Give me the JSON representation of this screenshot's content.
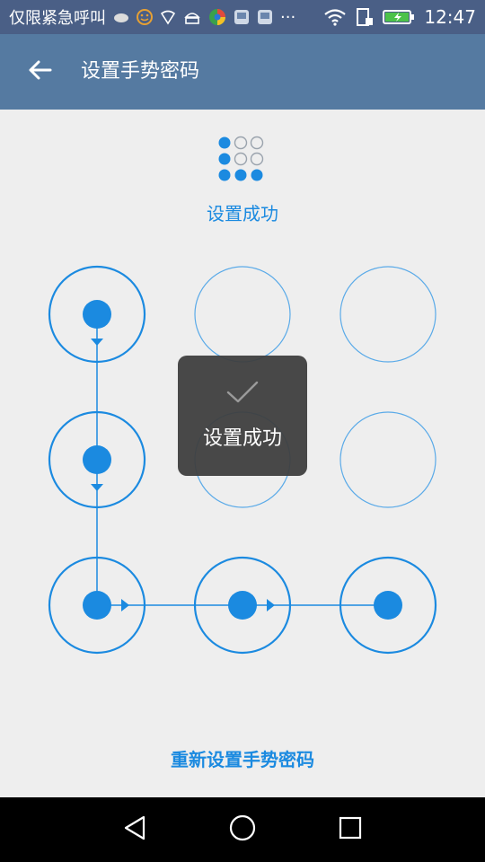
{
  "status_bar": {
    "carrier_text": "仅限紧急呼叫",
    "more_indicator": "···",
    "time": "12:47",
    "icons_left": [
      "weather-icon",
      "face-icon",
      "shield-icon",
      "android-icon",
      "app-icon",
      "apk-icon",
      "apk-icon"
    ],
    "icons_right": [
      "wifi-icon",
      "sim-icon",
      "battery-charging-icon"
    ]
  },
  "app_bar": {
    "back_icon": "arrow-left-icon",
    "title": "设置手势密码"
  },
  "header": {
    "mini_pattern_icon": "pattern-preview-icon",
    "status": "设置成功"
  },
  "pattern": {
    "selected_sequence": [
      1,
      4,
      7,
      8,
      9
    ],
    "rows": 3,
    "cols": 3
  },
  "toast": {
    "icon": "check-icon",
    "text": "设置成功"
  },
  "footer": {
    "reset_label": "重新设置手势密码"
  },
  "nav_bar": {
    "back_icon": "triangle-back-icon",
    "home_icon": "circle-home-icon",
    "recents_icon": "square-recents-icon"
  },
  "colors": {
    "status_bar": "#4a5f86",
    "app_bar": "#557aa1",
    "accent": "#1b8ae0",
    "background": "#eeeeee"
  }
}
